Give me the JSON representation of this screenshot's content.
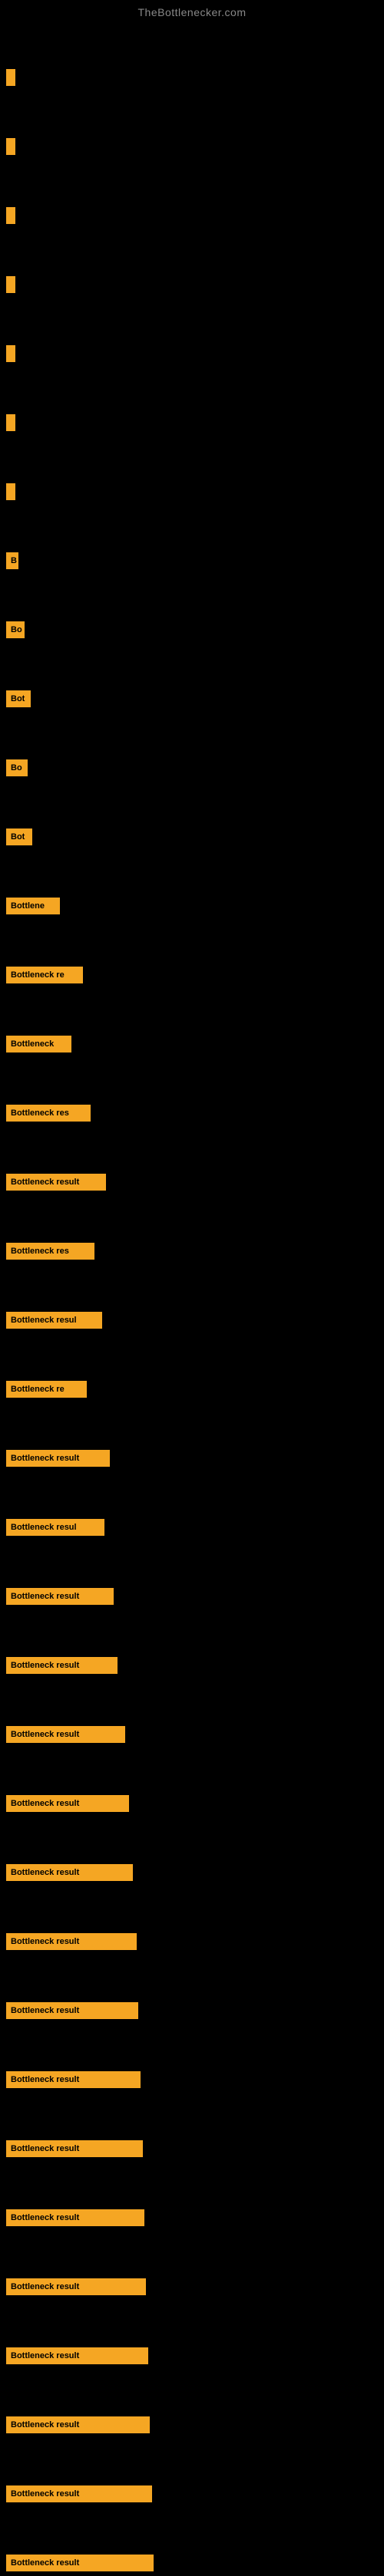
{
  "site": {
    "title": "TheBottlenecker.com"
  },
  "bars": [
    {
      "label": "",
      "width": 4
    },
    {
      "label": "",
      "width": 6
    },
    {
      "label": "",
      "width": 7
    },
    {
      "label": "",
      "width": 8
    },
    {
      "label": "",
      "width": 9
    },
    {
      "label": "",
      "width": 10
    },
    {
      "label": "",
      "width": 12
    },
    {
      "label": "B",
      "width": 16
    },
    {
      "label": "Bo",
      "width": 24
    },
    {
      "label": "Bot",
      "width": 32
    },
    {
      "label": "Bo",
      "width": 28
    },
    {
      "label": "Bot",
      "width": 34
    },
    {
      "label": "Bottlene",
      "width": 70
    },
    {
      "label": "Bottleneck re",
      "width": 100
    },
    {
      "label": "Bottleneck",
      "width": 85
    },
    {
      "label": "Bottleneck res",
      "width": 110
    },
    {
      "label": "Bottleneck result",
      "width": 130
    },
    {
      "label": "Bottleneck res",
      "width": 115
    },
    {
      "label": "Bottleneck resul",
      "width": 125
    },
    {
      "label": "Bottleneck re",
      "width": 105
    },
    {
      "label": "Bottleneck result",
      "width": 135
    },
    {
      "label": "Bottleneck resul",
      "width": 128
    },
    {
      "label": "Bottleneck result",
      "width": 140
    },
    {
      "label": "Bottleneck result",
      "width": 145
    },
    {
      "label": "Bottleneck result",
      "width": 155
    },
    {
      "label": "Bottleneck result",
      "width": 160
    },
    {
      "label": "Bottleneck result",
      "width": 165
    },
    {
      "label": "Bottleneck result",
      "width": 170
    },
    {
      "label": "Bottleneck result",
      "width": 172
    },
    {
      "label": "Bottleneck result",
      "width": 175
    },
    {
      "label": "Bottleneck result",
      "width": 178
    },
    {
      "label": "Bottleneck result",
      "width": 180
    },
    {
      "label": "Bottleneck result",
      "width": 182
    },
    {
      "label": "Bottleneck result",
      "width": 185
    },
    {
      "label": "Bottleneck result",
      "width": 187
    },
    {
      "label": "Bottleneck result",
      "width": 190
    },
    {
      "label": "Bottleneck result",
      "width": 192
    }
  ]
}
